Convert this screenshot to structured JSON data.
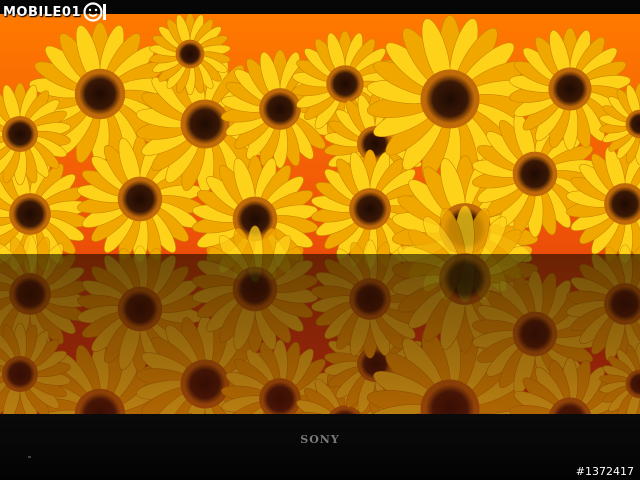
{
  "watermark": {
    "text": "MOBILE01",
    "logo_icon": "mobile01-smiley-logo"
  },
  "photo_id": "#1372417",
  "tv": {
    "brand": "SONY"
  },
  "scene": {
    "subject": "yellow-daisies",
    "colors": {
      "background_top": "#ff7a00",
      "background_bottom": "#d82a10",
      "petal": "#ffd21a",
      "petal_dark": "#f0a800",
      "center": "#3a1806",
      "center_ring": "#c06a08"
    }
  }
}
